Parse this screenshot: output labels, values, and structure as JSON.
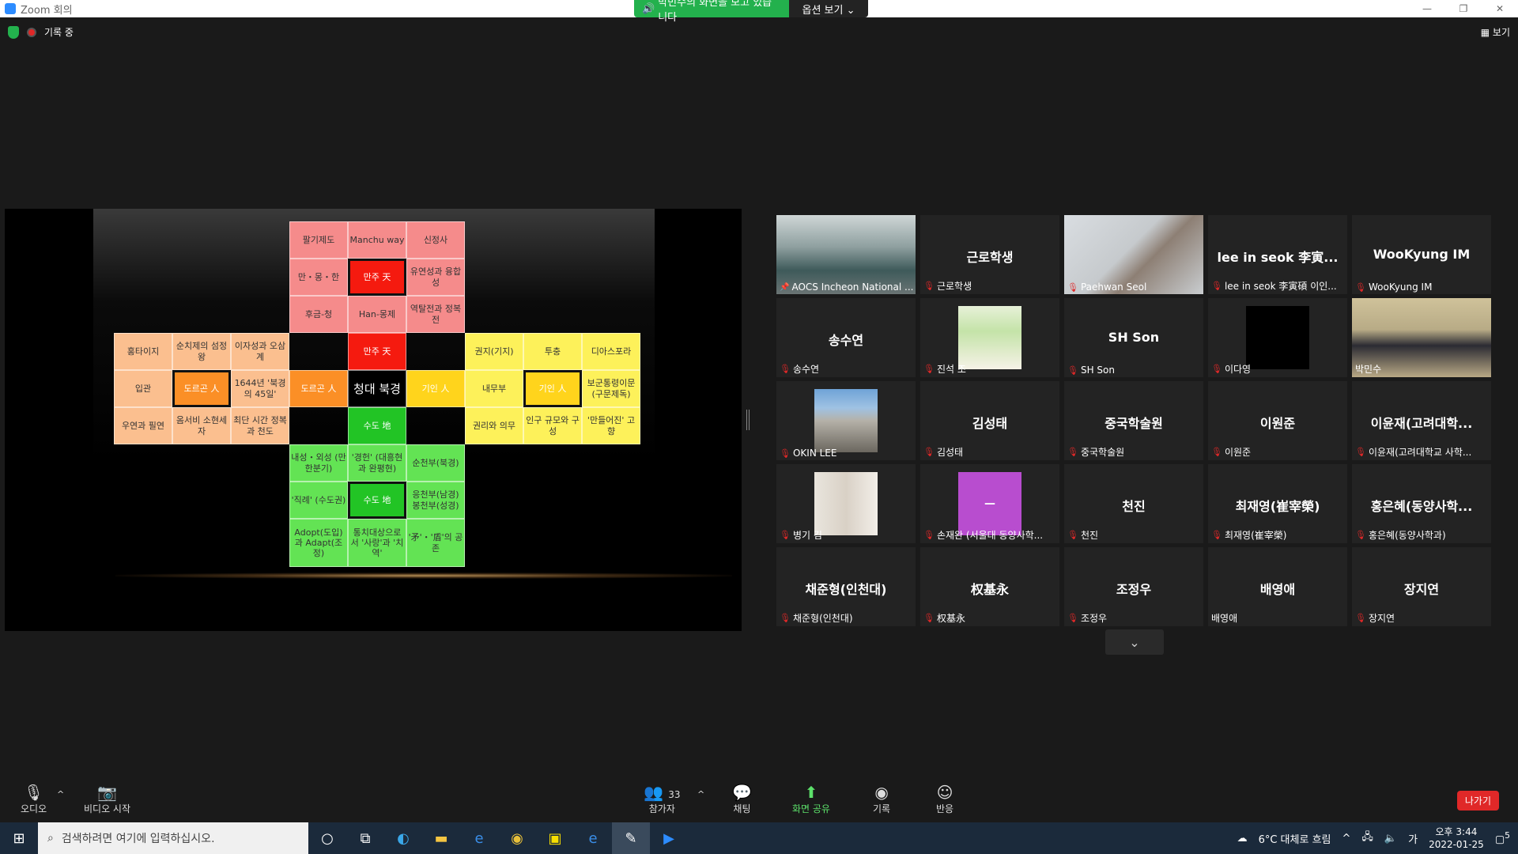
{
  "window": {
    "title": "Zoom 회의",
    "minimize": "—",
    "restore": "❐",
    "close": "✕"
  },
  "share_banner": {
    "text": "박민수의 화면을 보고 있습니다",
    "options": "옵션 보기 ⌄"
  },
  "top": {
    "recording": "기록 중",
    "view": "보기"
  },
  "slide": {
    "cells": [
      [
        "팔기제도",
        "Manchu way",
        "신정사"
      ],
      [
        "만・몽・한",
        "만주 天",
        "유연성과 융합성"
      ],
      [
        "후금-청",
        "Han-몽제",
        "역탈전과 정복전"
      ],
      [
        "만주 天"
      ],
      [
        "홍타이지",
        "순치제의 섬정왕",
        "이자성과 오삼계"
      ],
      [
        "입관",
        "도르곤 人",
        "1644년 '북경의 45일'"
      ],
      [
        "우연과 필연",
        "옴서비 소현세자",
        "최단 시간 정복과 천도"
      ],
      [
        "도르곤 人",
        "청대 북경",
        "기인 人"
      ],
      [
        "권지(기지)",
        "투충",
        "디아스포라"
      ],
      [
        "내무부",
        "기인 人",
        "보군통령이문(구문제독)"
      ],
      [
        "권리와 의무",
        "인구 규모와 구성",
        "'만들어진' 고향"
      ],
      [
        "수도 地"
      ],
      [
        "내성・외성 (만한분기)",
        "'경헌' (대흥현과 완평현)",
        "순천부(북경)"
      ],
      [
        "'직례' (수도권)",
        "수도 地",
        "응천부(남경) 봉천부(성경)"
      ],
      [
        "Adopt(도입)과 Adapt(조정)",
        "통치대상으로서 '사랑'과 '치역'",
        "'矛'・'盾'의 공존"
      ]
    ]
  },
  "participants": [
    {
      "name": "AOCS Incheon National ...",
      "big": "",
      "muted": false,
      "pin": true
    },
    {
      "name": "근로학생",
      "big": "근로학생",
      "muted": true
    },
    {
      "name": "Paehwan Seol",
      "big": "",
      "muted": true
    },
    {
      "name": "lee in seok 李寅碩 이인...",
      "big": "lee in seok 李寅...",
      "muted": true
    },
    {
      "name": "WooKyung IM",
      "big": "WooKyung IM",
      "muted": true
    },
    {
      "name": "송수연",
      "big": "송수연",
      "muted": true
    },
    {
      "name": "진석 조",
      "big": "",
      "muted": true
    },
    {
      "name": "SH Son",
      "big": "SH Son",
      "muted": true
    },
    {
      "name": "이다영",
      "big": "",
      "muted": true
    },
    {
      "name": "박민수",
      "big": "",
      "muted": false
    },
    {
      "name": "OKIN LEE",
      "big": "",
      "muted": true
    },
    {
      "name": "김성태",
      "big": "김성태",
      "muted": true
    },
    {
      "name": "중국학술원",
      "big": "중국학술원",
      "muted": true
    },
    {
      "name": "이원준",
      "big": "이원준",
      "muted": true
    },
    {
      "name": "이윤재(고려대학교 사학...",
      "big": "이윤재(고려대학...",
      "muted": true
    },
    {
      "name": "병기 김",
      "big": "",
      "muted": true
    },
    {
      "name": "손재완 (서울대 동양사학...",
      "big": "",
      "muted": true
    },
    {
      "name": "천진",
      "big": "천진",
      "muted": true
    },
    {
      "name": "최재영(崔宰榮)",
      "big": "최재영(崔宰榮)",
      "muted": true
    },
    {
      "name": "홍은혜(동양사학과)",
      "big": "홍은혜(동양사학...",
      "muted": true
    },
    {
      "name": "채준형(인천대)",
      "big": "채준형(인천대)",
      "muted": true
    },
    {
      "name": "权基永",
      "big": "权基永",
      "muted": true
    },
    {
      "name": "조정우",
      "big": "조정우",
      "muted": true
    },
    {
      "name": "배영애",
      "big": "배영애",
      "muted": false
    },
    {
      "name": "장지연",
      "big": "장지연",
      "muted": true
    }
  ],
  "purple_tile_text": "—",
  "toolbar": {
    "audio": "오디오",
    "video": "비디오 시작",
    "participants": "참가자",
    "participants_count": "33",
    "chat": "채팅",
    "share": "화면 공유",
    "record": "기록",
    "reactions": "반응",
    "leave": "나가기"
  },
  "taskbar": {
    "search_placeholder": "검색하려면 여기에 입력하십시오.",
    "weather": "6°C  대체로 흐림",
    "time": "오후 3:44",
    "date": "2022-01-25",
    "lang": "가",
    "notif": "5"
  }
}
